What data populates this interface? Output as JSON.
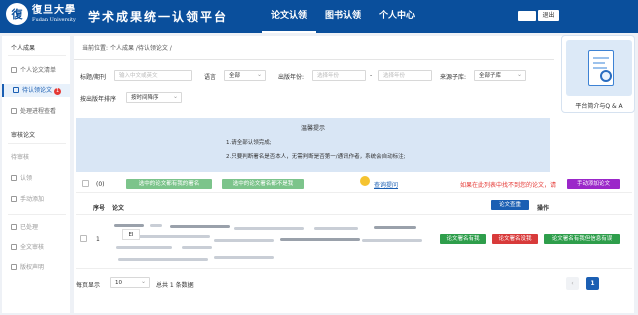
{
  "header": {
    "logo_seal": "復",
    "logo_cn": "復旦大學",
    "logo_en": "Fudan University",
    "platform_title": "学术成果统一认领平台",
    "nav": [
      "论文认领",
      "图书认领",
      "个人中心"
    ],
    "logout": "退出"
  },
  "sidebar": {
    "group1": "个人成果",
    "items": [
      {
        "label": "个人论文清单"
      },
      {
        "label": "待认领论文",
        "badge": "1"
      },
      {
        "label": "处理进程查看"
      }
    ],
    "group2": "审核论文",
    "items2": [
      {
        "label": "待审核"
      },
      {
        "label": "认领"
      },
      {
        "label": "手动添加"
      }
    ],
    "items3": [
      {
        "label": "已处理"
      },
      {
        "label": "全文审核"
      },
      {
        "label": "版权声明"
      }
    ]
  },
  "breadcrumb": {
    "prefix": "当前位置:",
    "path": "个人成果 /待认领论文 /"
  },
  "filters": {
    "title_label": "标题/期刊",
    "title_placeholder": "输入中文或英文",
    "lang_label": "语言",
    "lang_value": "全部",
    "year_label": "出版年份:",
    "year_from_placeholder": "选择年份",
    "year_sep": "-",
    "year_to_placeholder": "选择年份",
    "source_label": "来源子库:",
    "source_value": "全部子库",
    "sort_label": "按出版年排序",
    "sort_value": "按时间降序"
  },
  "notice": {
    "title": "温馨提示",
    "line1": "1.请全部认领完成;",
    "line2": "2.只要判断署名是否本人，无需判断是否第一/通讯作者，系统会自动标注;"
  },
  "actions": {
    "count": "(0)",
    "batch_mine": "选中的论文都有我的署名",
    "batch_not_mine": "选中的论文署名都不是我",
    "help_link": "查询提问",
    "missing_hint": "如果在此列表中找不到您的论文，请",
    "manual_add": "手动添加论文"
  },
  "table": {
    "col_index": "序号",
    "col_paper": "论文",
    "col_dup": "论文查重",
    "col_action": "操作",
    "rows": [
      {
        "index": "1",
        "tooltip": "EI",
        "btn_mine": "论文署名有我",
        "btn_not_mine": "论文署名没我",
        "btn_mine_correct": "论文署名有我但信息有误"
      }
    ]
  },
  "footer": {
    "per_page_label": "每页显示",
    "per_page_value": "10",
    "total": "总共 1 条数据",
    "prev": "‹",
    "current_page": "1"
  },
  "float": {
    "caption": "平台简介与Q & A"
  },
  "colors": {
    "header_bg": "#0a4f9c",
    "primary": "#1b5fb3",
    "notice_bg": "#d9e6f5",
    "btn_green": "#2e9e4b",
    "btn_red": "#d83a3a",
    "btn_purple": "#9b27c9"
  }
}
